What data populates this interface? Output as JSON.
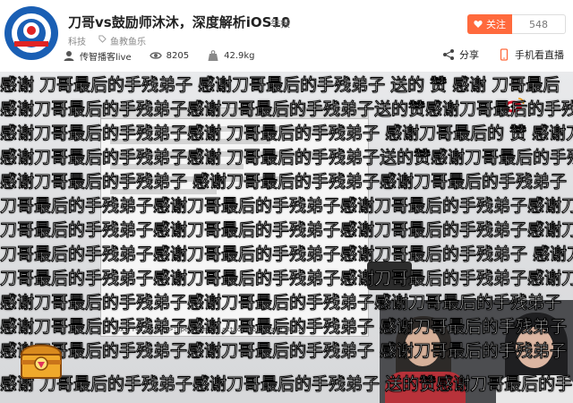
{
  "header": {
    "title": "刀哥vs鼓励师沐沐，深度解析iOS10",
    "report": "举报",
    "category": "科技",
    "tag": "鱼教鱼乐",
    "streamer": "传智播客live",
    "viewers": "8205",
    "weight": "42.9kg",
    "follow_label": "关注",
    "follow_count": "548",
    "share_label": "分享",
    "mobile_label": "手机看直播"
  },
  "video": {
    "terminal_text": "0x7ff4d2f42e00>: performing action for state Begin",
    "danmaku": [
      "感谢 刀哥最后的手残弟子 感谢刀哥最后的手残弟子 送的 赞 感谢 刀哥最后",
      "感谢刀哥最后的手残弟子感谢刀哥最后的手残弟子送的赞感谢刀哥最后的手残",
      "感谢刀哥最后的手残弟子感谢 刀哥最后的手残弟子 感谢刀哥最后的 赞 感谢刀哥最后",
      "感谢刀哥最后的手残弟子感谢 刀哥最后的手残弟子送的赞感谢刀哥最后的手残弟",
      "感谢刀哥最后的手残弟子 感谢刀哥最后的手残弟子感谢刀哥最后的手残弟子",
      "刀哥最后的手残弟子感谢刀哥最后的手残弟子感谢刀哥最后的手残弟子感谢刀哥",
      "刀哥最后的手残弟子感谢刀哥最后的手残弟子感谢刀哥最后的手残弟子感谢刀",
      "刀哥最后的手残弟子感谢刀哥最后的手残弟子感谢刀哥最后的手残弟子 感谢刀哥",
      "刀哥最后的手残弟子感谢刀哥最后的手残弟子感谢刀哥最后的手残弟子感谢刀哥",
      "感谢刀哥最后的手残弟子感谢刀哥最后的手残弟子感谢刀哥最后的手残弟子",
      "感谢刀哥最后的手残弟子感谢刀哥最后的手残弟子 感谢刀哥最后的手残弟子",
      "感谢刀哥最后的手残弟子感谢刀哥最后的手残弟子 感谢刀哥最后的手残弟子",
      "感谢 刀哥最后的手残弟子感谢刀哥最后的手残弟子 送的赞感谢刀哥最后的手"
    ]
  },
  "colors": {
    "accent": "#ff6a3d",
    "logo_blue": "#1a5fb4",
    "logo_red": "#e02424"
  },
  "icons": [
    "channel-logo",
    "tag-icon",
    "user-icon",
    "eye-icon",
    "weight-icon",
    "heart-icon",
    "share-icon",
    "mobile-icon",
    "weibo-icon",
    "treasure-chest-icon"
  ]
}
